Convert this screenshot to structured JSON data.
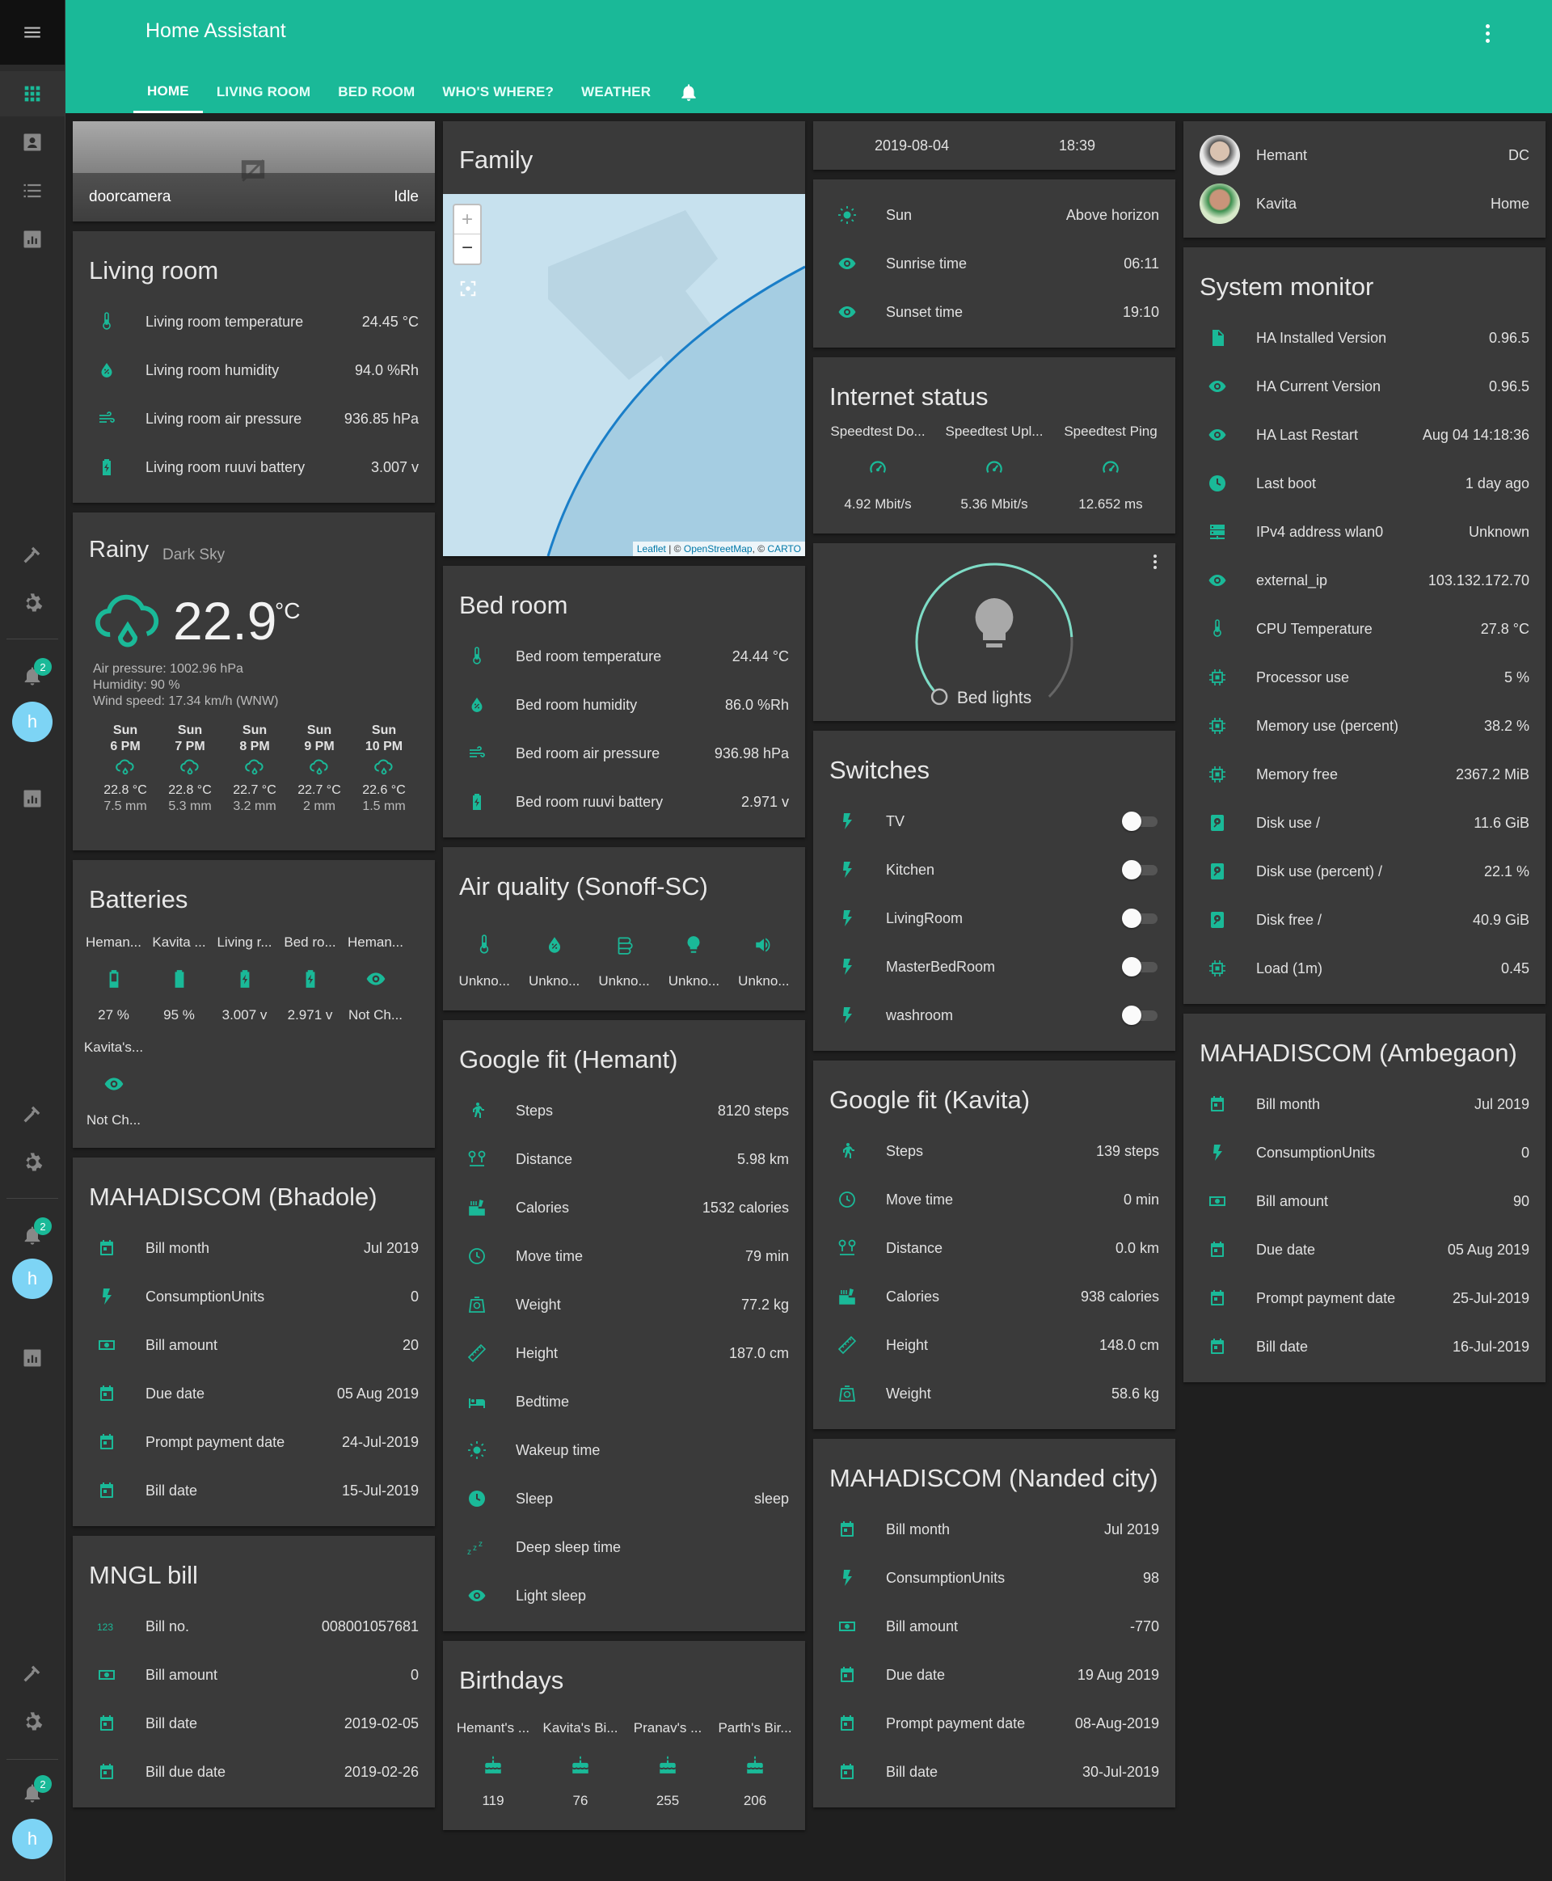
{
  "app": {
    "title": "Home Assistant"
  },
  "tabs": [
    "HOME",
    "LIVING ROOM",
    "BED ROOM",
    "WHO'S WHERE?",
    "WEATHER"
  ],
  "sidebar": {
    "badge": "2",
    "avatar": "h"
  },
  "doorcamera": {
    "name": "doorcamera",
    "state": "Idle"
  },
  "living_room": {
    "title": "Living room",
    "rows": [
      {
        "icon": "thermometer-icon",
        "name": "Living room temperature",
        "value": "24.45 °C"
      },
      {
        "icon": "water-percent-icon",
        "name": "Living room humidity",
        "value": "94.0 %Rh"
      },
      {
        "icon": "gauge-wind-icon",
        "name": "Living room air pressure",
        "value": "936.85 hPa"
      },
      {
        "icon": "battery-charging-icon",
        "name": "Living room ruuvi battery",
        "value": "3.007 v"
      }
    ]
  },
  "weather": {
    "condition": "Rainy",
    "source": "Dark Sky",
    "temp": "22.9",
    "unit": "°C",
    "pressure": "Air pressure: 1002.96 hPa",
    "humidity": "Humidity: 90 %",
    "wind": "Wind speed: 17.34 km/h (WNW)",
    "forecast": [
      {
        "day": "Sun",
        "hour": "6 PM",
        "temp": "22.8 °C",
        "precip": "7.5 mm"
      },
      {
        "day": "Sun",
        "hour": "7 PM",
        "temp": "22.8 °C",
        "precip": "5.3 mm"
      },
      {
        "day": "Sun",
        "hour": "8 PM",
        "temp": "22.7 °C",
        "precip": "3.2 mm"
      },
      {
        "day": "Sun",
        "hour": "9 PM",
        "temp": "22.7 °C",
        "precip": "2 mm"
      },
      {
        "day": "Sun",
        "hour": "10 PM",
        "temp": "22.6 °C",
        "precip": "1.5 mm"
      }
    ]
  },
  "batteries": {
    "title": "Batteries",
    "items": [
      {
        "name": "Heman...",
        "icon": "battery-icon",
        "value": "27 %"
      },
      {
        "name": "Kavita ...",
        "icon": "battery-full-icon",
        "value": "95 %"
      },
      {
        "name": "Living r...",
        "icon": "battery-charging-icon",
        "value": "3.007 v"
      },
      {
        "name": "Bed ro...",
        "icon": "battery-charging-icon",
        "value": "2.971 v"
      },
      {
        "name": "Heman...",
        "icon": "eye-icon",
        "value": "Not Ch..."
      },
      {
        "name": "Kavita's...",
        "icon": "eye-icon",
        "value": "Not Ch..."
      }
    ]
  },
  "mahadiscom_bhadole": {
    "title": "MAHADISCOM (Bhadole)",
    "rows": [
      {
        "icon": "calendar-icon",
        "name": "Bill month",
        "value": "Jul 2019"
      },
      {
        "icon": "flash-icon",
        "name": "ConsumptionUnits",
        "value": "0"
      },
      {
        "icon": "cash-icon",
        "name": "Bill amount",
        "value": "20"
      },
      {
        "icon": "calendar-icon",
        "name": "Due date",
        "value": "05 Aug 2019"
      },
      {
        "icon": "calendar-icon",
        "name": "Prompt payment date",
        "value": "24-Jul-2019"
      },
      {
        "icon": "calendar-icon",
        "name": "Bill date",
        "value": "15-Jul-2019"
      }
    ]
  },
  "mngl": {
    "title": "MNGL bill",
    "rows": [
      {
        "icon": "numeric-icon",
        "name": "Bill no.",
        "value": "008001057681"
      },
      {
        "icon": "cash-icon",
        "name": "Bill amount",
        "value": "0"
      },
      {
        "icon": "calendar-icon",
        "name": "Bill date",
        "value": "2019-02-05"
      },
      {
        "icon": "calendar-icon",
        "name": "Bill due date",
        "value": "2019-02-26"
      }
    ]
  },
  "family": {
    "title": "Family",
    "attribution_leaflet": "Leaflet",
    "attribution_rest": " | © ",
    "attribution_osm": "OpenStreetMap",
    "attribution_sep": ", © ",
    "attribution_carto": "CARTO",
    "zoom_in": "+",
    "zoom_out": "−"
  },
  "bed_room": {
    "title": "Bed room",
    "rows": [
      {
        "icon": "thermometer-icon",
        "name": "Bed room temperature",
        "value": "24.44 °C"
      },
      {
        "icon": "water-percent-icon",
        "name": "Bed room humidity",
        "value": "86.0 %Rh"
      },
      {
        "icon": "gauge-wind-icon",
        "name": "Bed room air pressure",
        "value": "936.98 hPa"
      },
      {
        "icon": "battery-charging-icon",
        "name": "Bed room ruuvi battery",
        "value": "2.971 v"
      }
    ]
  },
  "air_quality": {
    "title": "Air quality (Sonoff-SC)",
    "items": [
      {
        "icon": "thermometer-icon",
        "value": "Unkno..."
      },
      {
        "icon": "water-percent-icon",
        "value": "Unkno..."
      },
      {
        "icon": "air-filter-icon",
        "value": "Unkno..."
      },
      {
        "icon": "lightbulb-icon",
        "value": "Unkno..."
      },
      {
        "icon": "volume-icon",
        "value": "Unkno..."
      }
    ]
  },
  "google_fit_hemant": {
    "title": "Google fit (Hemant)",
    "rows": [
      {
        "icon": "walk-icon",
        "name": "Steps",
        "value": "8120 steps"
      },
      {
        "icon": "map-marker-distance-icon",
        "name": "Distance",
        "value": "5.98 km"
      },
      {
        "icon": "food-icon",
        "name": "Calories",
        "value": "1532 calories"
      },
      {
        "icon": "clock-outline-icon",
        "name": "Move time",
        "value": "79 min"
      },
      {
        "icon": "scale-icon",
        "name": "Weight",
        "value": "77.2 kg"
      },
      {
        "icon": "ruler-icon",
        "name": "Height",
        "value": "187.0 cm"
      },
      {
        "icon": "bed-icon",
        "name": "Bedtime",
        "value": ""
      },
      {
        "icon": "sun-icon",
        "name": "Wakeup time",
        "value": ""
      },
      {
        "icon": "clock-icon",
        "name": "Sleep",
        "value": "sleep"
      },
      {
        "icon": "sleep-zzz-icon",
        "name": "Deep sleep time",
        "value": ""
      },
      {
        "icon": "eye-icon",
        "name": "Light sleep",
        "value": ""
      }
    ]
  },
  "birthdays": {
    "title": "Birthdays",
    "items": [
      {
        "name": "Hemant's ...",
        "value": "119"
      },
      {
        "name": "Kavita's Bi...",
        "value": "76"
      },
      {
        "name": "Pranav's ...",
        "value": "255"
      },
      {
        "name": "Parth's Bir...",
        "value": "206"
      }
    ]
  },
  "datetime": {
    "date": "2019-08-04",
    "time": "18:39"
  },
  "sun": {
    "rows": [
      {
        "icon": "sun-icon",
        "name": "Sun",
        "value": "Above horizon"
      },
      {
        "icon": "eye-icon",
        "name": "Sunrise time",
        "value": "06:11"
      },
      {
        "icon": "eye-icon",
        "name": "Sunset time",
        "value": "19:10"
      }
    ]
  },
  "internet": {
    "title": "Internet status",
    "items": [
      {
        "name": "Speedtest Do...",
        "value": "4.92 Mbit/s"
      },
      {
        "name": "Speedtest Upl...",
        "value": "5.36 Mbit/s"
      },
      {
        "name": "Speedtest Ping",
        "value": "12.652 ms"
      }
    ]
  },
  "bed_lights": {
    "name": "Bed lights",
    "brightness_fraction": 0.82
  },
  "switches": {
    "title": "Switches",
    "rows": [
      {
        "name": "TV"
      },
      {
        "name": "Kitchen"
      },
      {
        "name": "LivingRoom"
      },
      {
        "name": "MasterBedRoom"
      },
      {
        "name": "washroom"
      }
    ]
  },
  "google_fit_kavita": {
    "title": "Google fit (Kavita)",
    "rows": [
      {
        "icon": "walk-icon",
        "name": "Steps",
        "value": "139 steps"
      },
      {
        "icon": "clock-outline-icon",
        "name": "Move time",
        "value": "0 min"
      },
      {
        "icon": "map-marker-distance-icon",
        "name": "Distance",
        "value": "0.0 km"
      },
      {
        "icon": "food-icon",
        "name": "Calories",
        "value": "938 calories"
      },
      {
        "icon": "ruler-icon",
        "name": "Height",
        "value": "148.0 cm"
      },
      {
        "icon": "scale-icon",
        "name": "Weight",
        "value": "58.6 kg"
      }
    ]
  },
  "mahadiscom_nanded": {
    "title": "MAHADISCOM (Nanded city)",
    "rows": [
      {
        "icon": "calendar-icon",
        "name": "Bill month",
        "value": "Jul 2019"
      },
      {
        "icon": "flash-icon",
        "name": "ConsumptionUnits",
        "value": "98"
      },
      {
        "icon": "cash-icon",
        "name": "Bill amount",
        "value": "-770"
      },
      {
        "icon": "calendar-icon",
        "name": "Due date",
        "value": "19 Aug 2019"
      },
      {
        "icon": "calendar-icon",
        "name": "Prompt payment date",
        "value": "08-Aug-2019"
      },
      {
        "icon": "calendar-icon",
        "name": "Bill date",
        "value": "30-Jul-2019"
      }
    ]
  },
  "people": {
    "rows": [
      {
        "name": "Hemant",
        "value": "DC"
      },
      {
        "name": "Kavita",
        "value": "Home"
      }
    ]
  },
  "system_monitor": {
    "title": "System monitor",
    "rows": [
      {
        "icon": "file-icon",
        "name": "HA Installed Version",
        "value": "0.96.5"
      },
      {
        "icon": "eye-icon",
        "name": "HA Current Version",
        "value": "0.96.5"
      },
      {
        "icon": "eye-icon",
        "name": "HA Last Restart",
        "value": "Aug 04 14:18:36"
      },
      {
        "icon": "clock-icon",
        "name": "Last boot",
        "value": "1 day ago"
      },
      {
        "icon": "server-network-icon",
        "name": "IPv4 address wlan0",
        "value": "Unknown"
      },
      {
        "icon": "eye-icon",
        "name": "external_ip",
        "value": "103.132.172.70"
      },
      {
        "icon": "thermometer-icon",
        "name": "CPU Temperature",
        "value": "27.8 °C"
      },
      {
        "icon": "chip-icon",
        "name": "Processor use",
        "value": "5 %"
      },
      {
        "icon": "chip-icon",
        "name": "Memory use (percent)",
        "value": "38.2 %"
      },
      {
        "icon": "chip-icon",
        "name": "Memory free",
        "value": "2367.2 MiB"
      },
      {
        "icon": "harddisk-icon",
        "name": "Disk use /",
        "value": "11.6 GiB"
      },
      {
        "icon": "harddisk-icon",
        "name": "Disk use (percent) /",
        "value": "22.1 %"
      },
      {
        "icon": "harddisk-icon",
        "name": "Disk free /",
        "value": "40.9 GiB"
      },
      {
        "icon": "chip-icon",
        "name": "Load (1m)",
        "value": "0.45"
      }
    ]
  },
  "mahadiscom_ambegaon": {
    "title": "MAHADISCOM (Ambegaon)",
    "rows": [
      {
        "icon": "calendar-icon",
        "name": "Bill month",
        "value": "Jul 2019"
      },
      {
        "icon": "flash-icon",
        "name": "ConsumptionUnits",
        "value": "0"
      },
      {
        "icon": "cash-icon",
        "name": "Bill amount",
        "value": "90"
      },
      {
        "icon": "calendar-icon",
        "name": "Due date",
        "value": "05 Aug 2019"
      },
      {
        "icon": "calendar-icon",
        "name": "Prompt payment date",
        "value": "25-Jul-2019"
      },
      {
        "icon": "calendar-icon",
        "name": "Bill date",
        "value": "16-Jul-2019"
      }
    ]
  },
  "colors": {
    "accent": "#1ab998",
    "card": "#3a3a3a",
    "background": "#1f1f1f"
  }
}
